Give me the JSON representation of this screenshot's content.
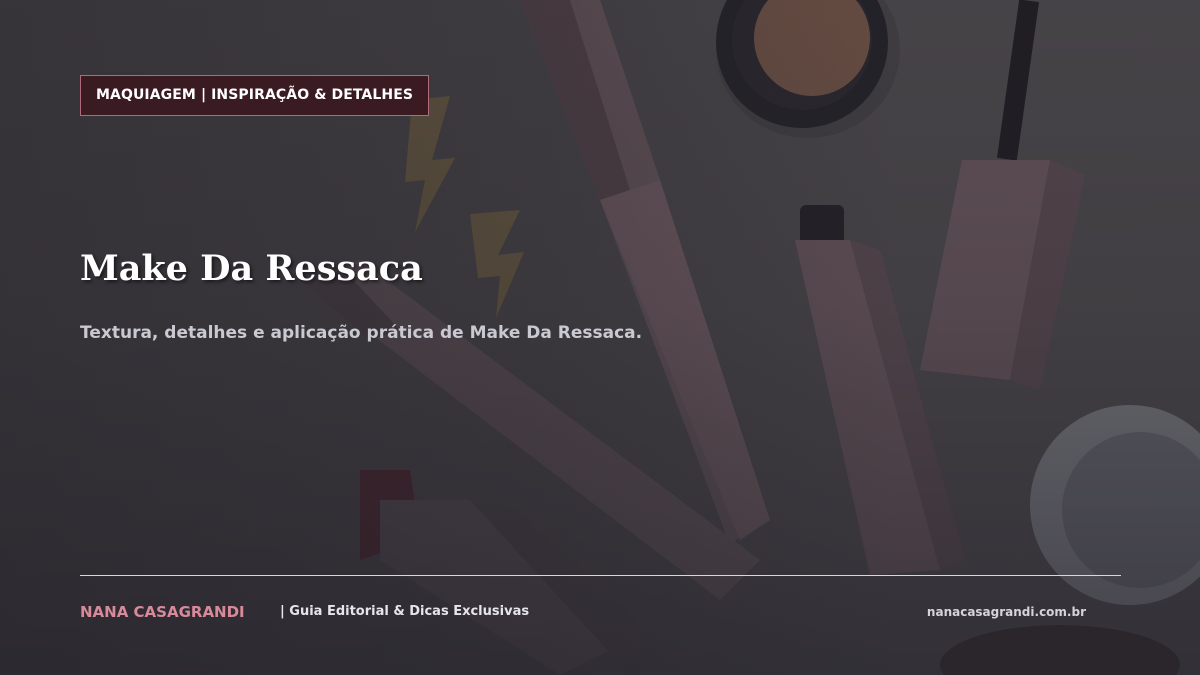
{
  "header": {
    "category_badge": "MAQUIAGEM | INSPIRAÇÃO & DETALHES"
  },
  "main": {
    "title": "Make Da Ressaca",
    "subtitle": "Textura, detalhes e aplicação prática de Make Da Ressaca."
  },
  "footer": {
    "brand": "NANA CASAGRANDI",
    "tagline": "| Guia Editorial & Dicas Exclusivas",
    "url": "nanacasagrandi.com.br"
  },
  "colors": {
    "badge_background": "#3a1b22",
    "badge_border": "#b06a7a",
    "brand_accent": "#d98a9a",
    "title_text": "#ffffff",
    "subtitle_text": "#c9c9d2"
  },
  "background": {
    "icons": [
      "brush-icon",
      "lipstick-icon",
      "mascara-icon",
      "compact-powder-icon",
      "cream-pot-icon",
      "lightning-earring-icon"
    ]
  }
}
